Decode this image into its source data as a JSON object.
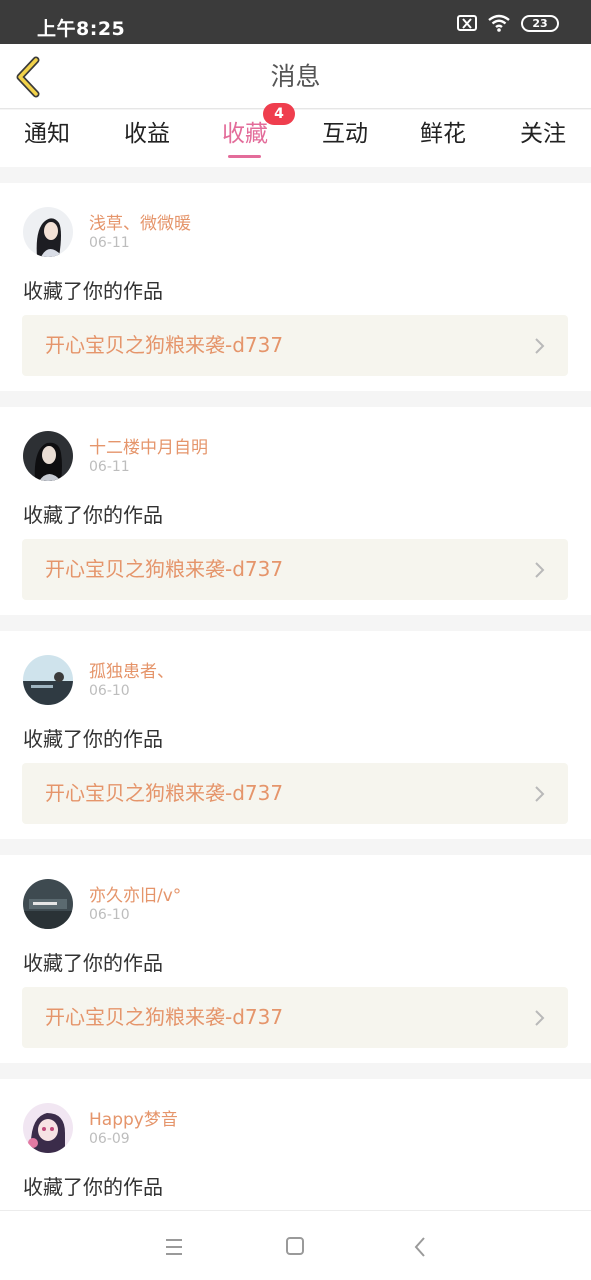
{
  "status_bar": {
    "time": "上午8:25",
    "battery": "23"
  },
  "header": {
    "title": "消息"
  },
  "tabs": [
    {
      "label": "通知"
    },
    {
      "label": "收益"
    },
    {
      "label": "收藏",
      "badge": "4",
      "active": true
    },
    {
      "label": "互动"
    },
    {
      "label": "鲜花"
    },
    {
      "label": "关注"
    }
  ],
  "feed": [
    {
      "username": "浅草、微微暖",
      "date": "06-11",
      "action": "收藏了你的作品",
      "work": "开心宝贝之狗粮来袭-d737"
    },
    {
      "username": "十二楼中月自明",
      "date": "06-11",
      "action": "收藏了你的作品",
      "work": "开心宝贝之狗粮来袭-d737"
    },
    {
      "username": "孤独患者、",
      "date": "06-10",
      "action": "收藏了你的作品",
      "work": "开心宝贝之狗粮来袭-d737"
    },
    {
      "username": "亦久亦旧/v°",
      "date": "06-10",
      "action": "收藏了你的作品",
      "work": "开心宝贝之狗粮来袭-d737"
    },
    {
      "username": "Happy梦音",
      "date": "06-09",
      "action": "收藏了你的作品",
      "work": ""
    }
  ],
  "colors": {
    "accent": "#e36c9a",
    "name": "#e5956b",
    "badge": "#ef3e4e"
  }
}
